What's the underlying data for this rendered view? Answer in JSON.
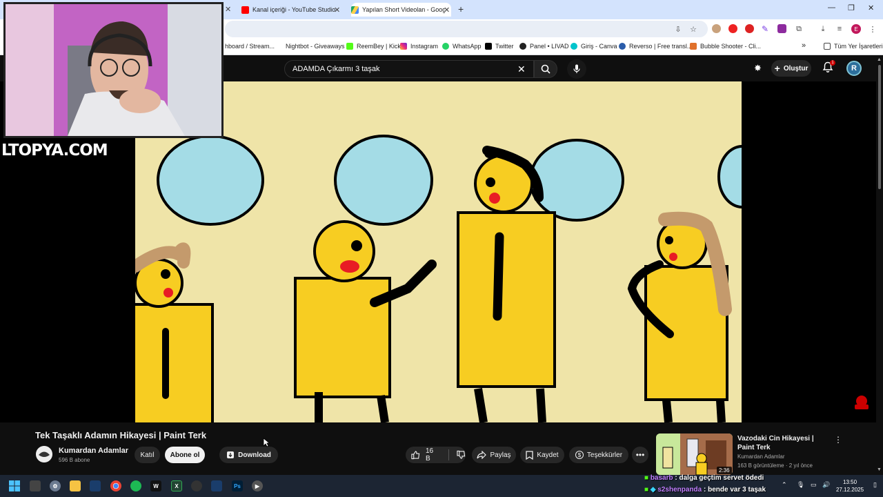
{
  "browser": {
    "tabs": [
      {
        "label": "Kanal içeriği - YouTube Studio",
        "color": "#ff0000"
      },
      {
        "label": "Yapılan Short Videolan - Googl",
        "color": "#1fa463"
      }
    ],
    "bookmarks": [
      {
        "label": "hboard / Stream...",
        "color": "#9147ff"
      },
      {
        "label": "Nightbot - Giveaways",
        "color": "#ffffff"
      },
      {
        "label": "ReemBey | Kick",
        "color": "#53fc18"
      },
      {
        "label": "Instagram",
        "color": "#d6249f"
      },
      {
        "label": "WhatsApp",
        "color": "#25d366"
      },
      {
        "label": "Twitter",
        "color": "#000000"
      },
      {
        "label": "Panel • LIVAD",
        "color": "#222222"
      },
      {
        "label": "Giriş - Canva",
        "color": "#00c4cc"
      },
      {
        "label": "Reverso | Free transl...",
        "color": "#2a5caa"
      },
      {
        "label": "Bubble Shooter - Cli...",
        "color": "#e0712b"
      }
    ],
    "all_bookmarks": "Tüm Yer İşaretleri",
    "profile_letter": "E"
  },
  "youtube": {
    "search_query": "ADAMDA Çıkarmı 3 taşak",
    "create_label": "Oluştur",
    "notification_count": "1",
    "avatar_letter": "R"
  },
  "stream": {
    "watermark": "LTOPYA.COM"
  },
  "video": {
    "title": "Tek Taşaklı Adamın Hikayesi | Paint Terk",
    "channel": "Kumardan Adamlar",
    "subscribers": "596 B abone",
    "join_label": "Katıl",
    "subscribe_label": "Abone ol",
    "download_label": "Download",
    "likes": "16 B",
    "share_label": "Paylaş",
    "save_label": "Kaydet",
    "thanks_label": "Teşekkürler"
  },
  "recommendation": {
    "title": "Vazodaki Cin Hikayesi | Paint Terk",
    "channel": "Kumardan Adamlar",
    "meta": "163 B görüntüleme · 2 yıl önce",
    "duration": "2:36"
  },
  "chat": [
    {
      "user": "basarb",
      "message": ": dalga geçtim servet ödedi"
    },
    {
      "user": "s2shenpanda",
      "message": ": bende var 3 taşak"
    }
  ],
  "clock": {
    "time": "13:50",
    "date": "27.12.2025"
  }
}
